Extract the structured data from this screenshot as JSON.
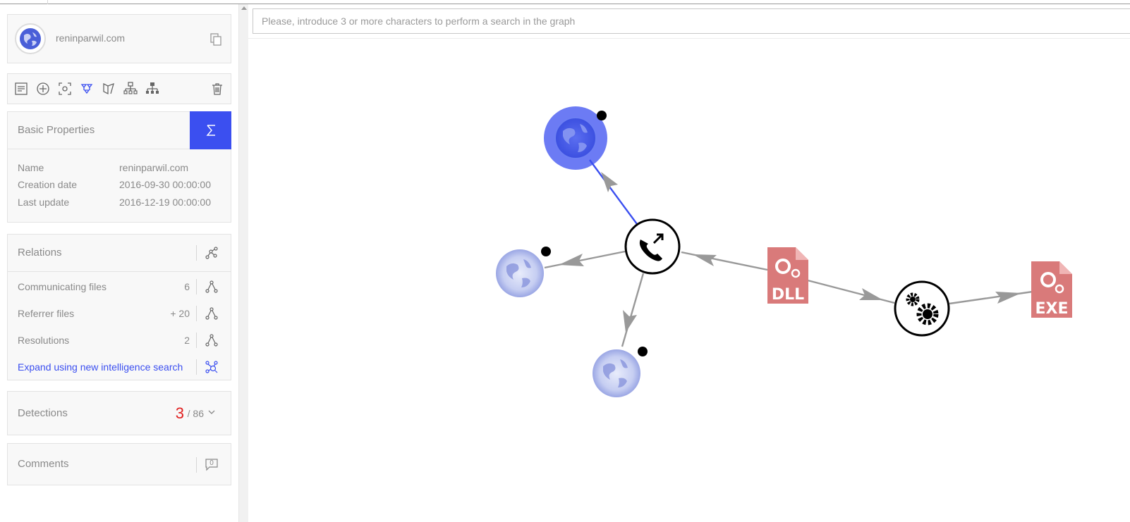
{
  "entity": {
    "name": "reninparwil.com",
    "icon": "globe-icon"
  },
  "toolbar": {
    "tools": [
      "properties-icon",
      "add-node-icon",
      "focus-icon",
      "expand-icon",
      "filter-icon",
      "hierarchy-icon",
      "hierarchy-alt-icon",
      "trash-icon"
    ]
  },
  "basic_properties": {
    "title": "Basic Properties",
    "rows": [
      {
        "label": "Name",
        "value": "reninparwil.com"
      },
      {
        "label": "Creation date",
        "value": "2016-09-30 00:00:00"
      },
      {
        "label": "Last update",
        "value": "2016-12-19 00:00:00"
      }
    ]
  },
  "relations": {
    "title": "Relations",
    "rows": [
      {
        "label": "Communicating files",
        "count": "6"
      },
      {
        "label": "Referrer files",
        "count": "+ 20"
      },
      {
        "label": "Resolutions",
        "count": "2"
      }
    ],
    "expand_label": "Expand using new intelligence search"
  },
  "detections": {
    "title": "Detections",
    "positives": "3",
    "total": "/ 86"
  },
  "comments": {
    "title": "Comments",
    "count": "0"
  },
  "search": {
    "placeholder": "Please, introduce 3 or more characters to perform a search in the graph"
  },
  "graph": {
    "nodes": [
      {
        "name": "domain-selected",
        "icon": "globe-icon",
        "selected": true
      },
      {
        "name": "domain-left",
        "icon": "globe-icon"
      },
      {
        "name": "domain-bottom",
        "icon": "globe-icon"
      },
      {
        "name": "hub",
        "icon": "phone-callback-icon"
      },
      {
        "name": "dll-file",
        "icon": "dll-file-icon",
        "label": "DLL"
      },
      {
        "name": "process",
        "icon": "gears-icon"
      },
      {
        "name": "exe-file",
        "icon": "exe-file-icon",
        "label": "EXE"
      }
    ],
    "colors": {
      "selected": "#3b4ff0",
      "file": "#d97a7a",
      "edge": "#9a9a9a",
      "accent": "#3b4ff0"
    }
  }
}
